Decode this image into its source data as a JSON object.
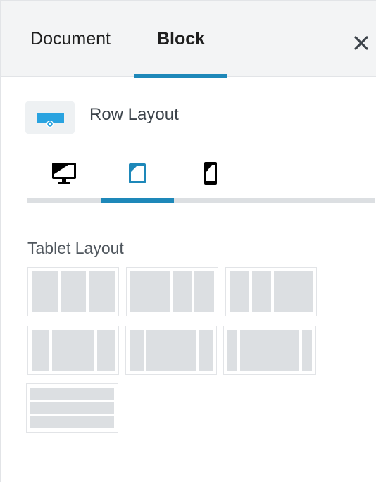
{
  "tabs": {
    "document_label": "Document",
    "block_label": "Block",
    "active": "Block",
    "close_icon": "close-icon"
  },
  "block": {
    "title": "Row Layout",
    "icon": "row-layout-block-icon"
  },
  "device_tabs": {
    "items": [
      {
        "name": "desktop",
        "icon": "desktop-icon"
      },
      {
        "name": "tablet",
        "icon": "tablet-icon"
      },
      {
        "name": "mobile",
        "icon": "mobile-icon"
      }
    ],
    "active": "tablet"
  },
  "layout_section": {
    "label": "Tablet Layout",
    "options": [
      {
        "name": "equal-thirds",
        "columns": [
          1,
          1,
          1
        ]
      },
      {
        "name": "left-half",
        "columns": [
          2,
          1,
          1
        ]
      },
      {
        "name": "right-half",
        "columns": [
          1,
          1,
          2
        ]
      },
      {
        "name": "center-half",
        "columns": [
          1,
          2,
          1
        ]
      },
      {
        "name": "center-wide",
        "columns": [
          1,
          4,
          1
        ]
      },
      {
        "name": "center-exwide",
        "columns": [
          1,
          7,
          1
        ]
      },
      {
        "name": "row-collapse",
        "rows": 3
      }
    ]
  },
  "colors": {
    "accent": "#1e88b9",
    "header_bg": "#f3f4f5",
    "column_fill": "#dcdfe2",
    "block_icon": "#29a3e0"
  }
}
